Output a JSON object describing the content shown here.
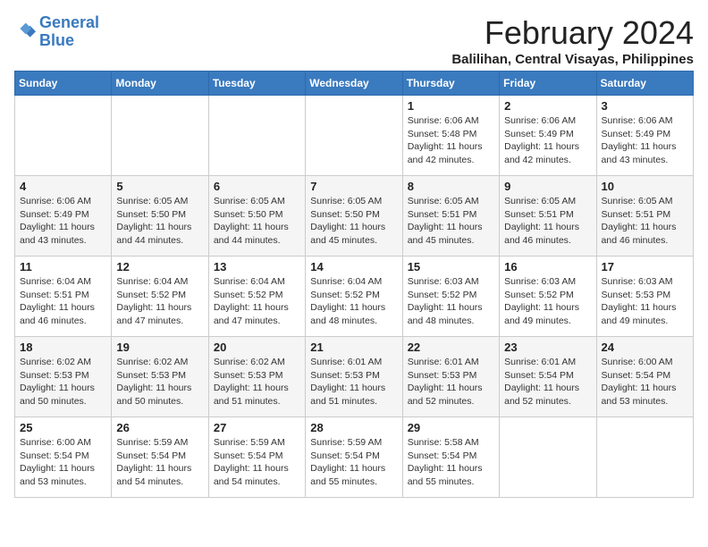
{
  "header": {
    "logo_line1": "General",
    "logo_line2": "Blue",
    "month_title": "February 2024",
    "subtitle": "Balilihan, Central Visayas, Philippines"
  },
  "weekdays": [
    "Sunday",
    "Monday",
    "Tuesday",
    "Wednesday",
    "Thursday",
    "Friday",
    "Saturday"
  ],
  "rows": [
    [
      {
        "day": "",
        "info": ""
      },
      {
        "day": "",
        "info": ""
      },
      {
        "day": "",
        "info": ""
      },
      {
        "day": "",
        "info": ""
      },
      {
        "day": "1",
        "info": "Sunrise: 6:06 AM\nSunset: 5:48 PM\nDaylight: 11 hours\nand 42 minutes."
      },
      {
        "day": "2",
        "info": "Sunrise: 6:06 AM\nSunset: 5:49 PM\nDaylight: 11 hours\nand 42 minutes."
      },
      {
        "day": "3",
        "info": "Sunrise: 6:06 AM\nSunset: 5:49 PM\nDaylight: 11 hours\nand 43 minutes."
      }
    ],
    [
      {
        "day": "4",
        "info": "Sunrise: 6:06 AM\nSunset: 5:49 PM\nDaylight: 11 hours\nand 43 minutes."
      },
      {
        "day": "5",
        "info": "Sunrise: 6:05 AM\nSunset: 5:50 PM\nDaylight: 11 hours\nand 44 minutes."
      },
      {
        "day": "6",
        "info": "Sunrise: 6:05 AM\nSunset: 5:50 PM\nDaylight: 11 hours\nand 44 minutes."
      },
      {
        "day": "7",
        "info": "Sunrise: 6:05 AM\nSunset: 5:50 PM\nDaylight: 11 hours\nand 45 minutes."
      },
      {
        "day": "8",
        "info": "Sunrise: 6:05 AM\nSunset: 5:51 PM\nDaylight: 11 hours\nand 45 minutes."
      },
      {
        "day": "9",
        "info": "Sunrise: 6:05 AM\nSunset: 5:51 PM\nDaylight: 11 hours\nand 46 minutes."
      },
      {
        "day": "10",
        "info": "Sunrise: 6:05 AM\nSunset: 5:51 PM\nDaylight: 11 hours\nand 46 minutes."
      }
    ],
    [
      {
        "day": "11",
        "info": "Sunrise: 6:04 AM\nSunset: 5:51 PM\nDaylight: 11 hours\nand 46 minutes."
      },
      {
        "day": "12",
        "info": "Sunrise: 6:04 AM\nSunset: 5:52 PM\nDaylight: 11 hours\nand 47 minutes."
      },
      {
        "day": "13",
        "info": "Sunrise: 6:04 AM\nSunset: 5:52 PM\nDaylight: 11 hours\nand 47 minutes."
      },
      {
        "day": "14",
        "info": "Sunrise: 6:04 AM\nSunset: 5:52 PM\nDaylight: 11 hours\nand 48 minutes."
      },
      {
        "day": "15",
        "info": "Sunrise: 6:03 AM\nSunset: 5:52 PM\nDaylight: 11 hours\nand 48 minutes."
      },
      {
        "day": "16",
        "info": "Sunrise: 6:03 AM\nSunset: 5:52 PM\nDaylight: 11 hours\nand 49 minutes."
      },
      {
        "day": "17",
        "info": "Sunrise: 6:03 AM\nSunset: 5:53 PM\nDaylight: 11 hours\nand 49 minutes."
      }
    ],
    [
      {
        "day": "18",
        "info": "Sunrise: 6:02 AM\nSunset: 5:53 PM\nDaylight: 11 hours\nand 50 minutes."
      },
      {
        "day": "19",
        "info": "Sunrise: 6:02 AM\nSunset: 5:53 PM\nDaylight: 11 hours\nand 50 minutes."
      },
      {
        "day": "20",
        "info": "Sunrise: 6:02 AM\nSunset: 5:53 PM\nDaylight: 11 hours\nand 51 minutes."
      },
      {
        "day": "21",
        "info": "Sunrise: 6:01 AM\nSunset: 5:53 PM\nDaylight: 11 hours\nand 51 minutes."
      },
      {
        "day": "22",
        "info": "Sunrise: 6:01 AM\nSunset: 5:53 PM\nDaylight: 11 hours\nand 52 minutes."
      },
      {
        "day": "23",
        "info": "Sunrise: 6:01 AM\nSunset: 5:54 PM\nDaylight: 11 hours\nand 52 minutes."
      },
      {
        "day": "24",
        "info": "Sunrise: 6:00 AM\nSunset: 5:54 PM\nDaylight: 11 hours\nand 53 minutes."
      }
    ],
    [
      {
        "day": "25",
        "info": "Sunrise: 6:00 AM\nSunset: 5:54 PM\nDaylight: 11 hours\nand 53 minutes."
      },
      {
        "day": "26",
        "info": "Sunrise: 5:59 AM\nSunset: 5:54 PM\nDaylight: 11 hours\nand 54 minutes."
      },
      {
        "day": "27",
        "info": "Sunrise: 5:59 AM\nSunset: 5:54 PM\nDaylight: 11 hours\nand 54 minutes."
      },
      {
        "day": "28",
        "info": "Sunrise: 5:59 AM\nSunset: 5:54 PM\nDaylight: 11 hours\nand 55 minutes."
      },
      {
        "day": "29",
        "info": "Sunrise: 5:58 AM\nSunset: 5:54 PM\nDaylight: 11 hours\nand 55 minutes."
      },
      {
        "day": "",
        "info": ""
      },
      {
        "day": "",
        "info": ""
      }
    ]
  ]
}
